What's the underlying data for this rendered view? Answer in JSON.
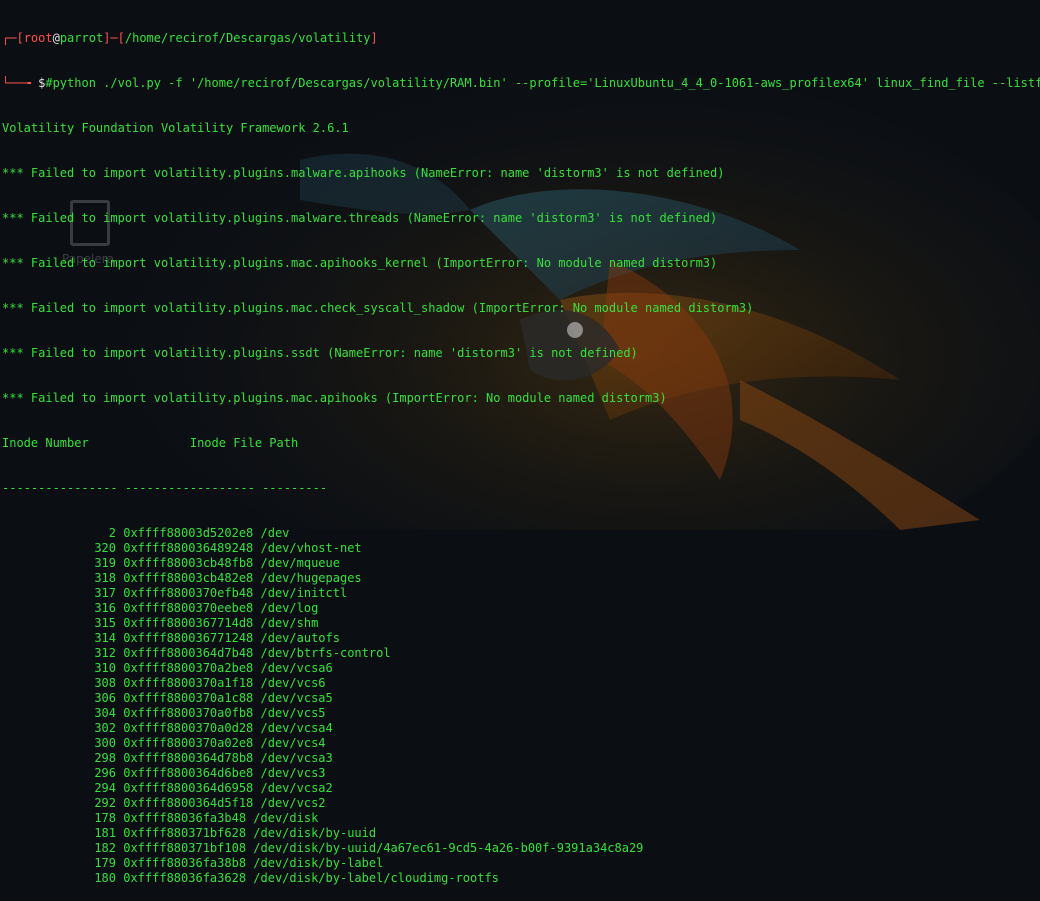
{
  "prompt": {
    "user": "root",
    "at": "@",
    "host": "parrot",
    "path": "/home/recirof/Descargas/volatility",
    "command": "#python ./vol.py -f '/home/recirof/Descargas/volatility/RAM.bin' --profile='LinuxUbuntu_4_4_0-1061-aws_profilex64' linux_find_file --listfiles"
  },
  "header_lines": [
    "Volatility Foundation Volatility Framework 2.6.1",
    "*** Failed to import volatility.plugins.malware.apihooks (NameError: name 'distorm3' is not defined)",
    "*** Failed to import volatility.plugins.malware.threads (NameError: name 'distorm3' is not defined)",
    "*** Failed to import volatility.plugins.mac.apihooks_kernel (ImportError: No module named distorm3)",
    "*** Failed to import volatility.plugins.mac.check_syscall_shadow (ImportError: No module named distorm3)",
    "*** Failed to import volatility.plugins.ssdt (NameError: name 'distorm3' is not defined)",
    "*** Failed to import volatility.plugins.mac.apihooks (ImportError: No module named distorm3)"
  ],
  "table_header": "Inode Number              Inode File Path",
  "table_separator": "---------------- ------------------ ---------",
  "rows": [
    {
      "num": "2",
      "inode": "0xffff88003d5202e8",
      "path": "/dev"
    },
    {
      "num": "320",
      "inode": "0xffff880036489248",
      "path": "/dev/vhost-net"
    },
    {
      "num": "319",
      "inode": "0xffff88003cb48fb8",
      "path": "/dev/mqueue"
    },
    {
      "num": "318",
      "inode": "0xffff88003cb482e8",
      "path": "/dev/hugepages"
    },
    {
      "num": "317",
      "inode": "0xffff8800370efb48",
      "path": "/dev/initctl"
    },
    {
      "num": "316",
      "inode": "0xffff8800370eebe8",
      "path": "/dev/log"
    },
    {
      "num": "315",
      "inode": "0xffff8800367714d8",
      "path": "/dev/shm"
    },
    {
      "num": "314",
      "inode": "0xffff880036771248",
      "path": "/dev/autofs"
    },
    {
      "num": "312",
      "inode": "0xffff8800364d7b48",
      "path": "/dev/btrfs-control"
    },
    {
      "num": "310",
      "inode": "0xffff8800370a2be8",
      "path": "/dev/vcsa6"
    },
    {
      "num": "308",
      "inode": "0xffff8800370a1f18",
      "path": "/dev/vcs6"
    },
    {
      "num": "306",
      "inode": "0xffff8800370a1c88",
      "path": "/dev/vcsa5"
    },
    {
      "num": "304",
      "inode": "0xffff8800370a0fb8",
      "path": "/dev/vcs5"
    },
    {
      "num": "302",
      "inode": "0xffff8800370a0d28",
      "path": "/dev/vcsa4"
    },
    {
      "num": "300",
      "inode": "0xffff8800370a02e8",
      "path": "/dev/vcs4"
    },
    {
      "num": "298",
      "inode": "0xffff8800364d78b8",
      "path": "/dev/vcsa3"
    },
    {
      "num": "296",
      "inode": "0xffff8800364d6be8",
      "path": "/dev/vcs3"
    },
    {
      "num": "294",
      "inode": "0xffff8800364d6958",
      "path": "/dev/vcsa2"
    },
    {
      "num": "292",
      "inode": "0xffff8800364d5f18",
      "path": "/dev/vcs2"
    },
    {
      "num": "178",
      "inode": "0xffff88036fa3b48",
      "path": "/dev/disk"
    },
    {
      "num": "181",
      "inode": "0xffff880371bf628",
      "path": "/dev/disk/by-uuid"
    },
    {
      "num": "182",
      "inode": "0xffff880371bf108",
      "path": "/dev/disk/by-uuid/4a67ec61-9cd5-4a26-b00f-9391a34c8a29"
    },
    {
      "num": "179",
      "inode": "0xffff88036fa38b8",
      "path": "/dev/disk/by-label"
    },
    {
      "num": "180",
      "inode": "0xffff88036fa3628",
      "path": "/dev/disk/by-label/cloudimg-rootfs"
    }
  ],
  "desktop_folder": {
    "label": "Papelera",
    "icon": "trash-icon"
  },
  "colors": {
    "prompt": "#ff5050",
    "text": "#36e03a",
    "command": "#36e03a",
    "background": "#0b0f14"
  }
}
